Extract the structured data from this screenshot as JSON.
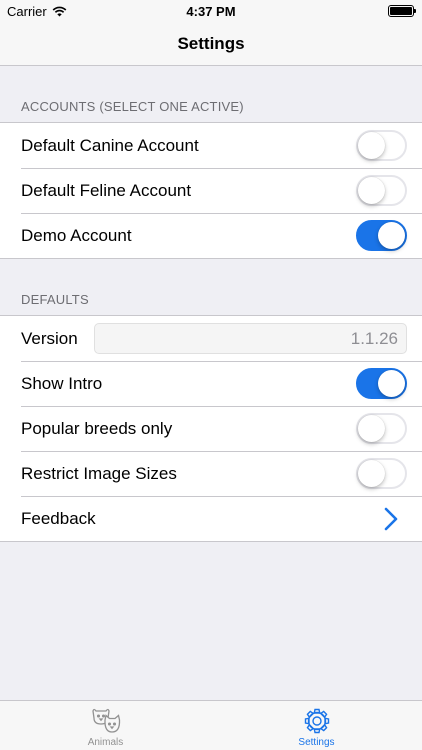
{
  "status_bar": {
    "carrier": "Carrier",
    "time": "4:37 PM",
    "icons": [
      "wifi-icon",
      "battery-icon"
    ]
  },
  "nav": {
    "title": "Settings"
  },
  "accounts": {
    "header": "ACCOUNTS (SELECT ONE ACTIVE)",
    "items": [
      {
        "label": "Default Canine Account",
        "on": false
      },
      {
        "label": "Default Feline Account",
        "on": false
      },
      {
        "label": "Demo Account",
        "on": true
      }
    ]
  },
  "defaults": {
    "header": "DEFAULTS",
    "version_label": "Version",
    "version_value": "1.1.26",
    "show_intro_label": "Show Intro",
    "show_intro_on": true,
    "popular_breeds_label": "Popular breeds only",
    "popular_breeds_on": false,
    "restrict_images_label": "Restrict Image Sizes",
    "restrict_images_on": false,
    "feedback_label": "Feedback",
    "feedback_icon": "chevron-right-icon"
  },
  "tabs": [
    {
      "label": "Animals",
      "icon": "animals-icon",
      "active": false
    },
    {
      "label": "Settings",
      "icon": "gear-icon",
      "active": true
    }
  ],
  "colors": {
    "accent": "#1a74e8",
    "background": "#efeff4",
    "separator": "#c8c7cc",
    "section_header_text": "#6d6d72",
    "inactive_tab": "#929292"
  }
}
